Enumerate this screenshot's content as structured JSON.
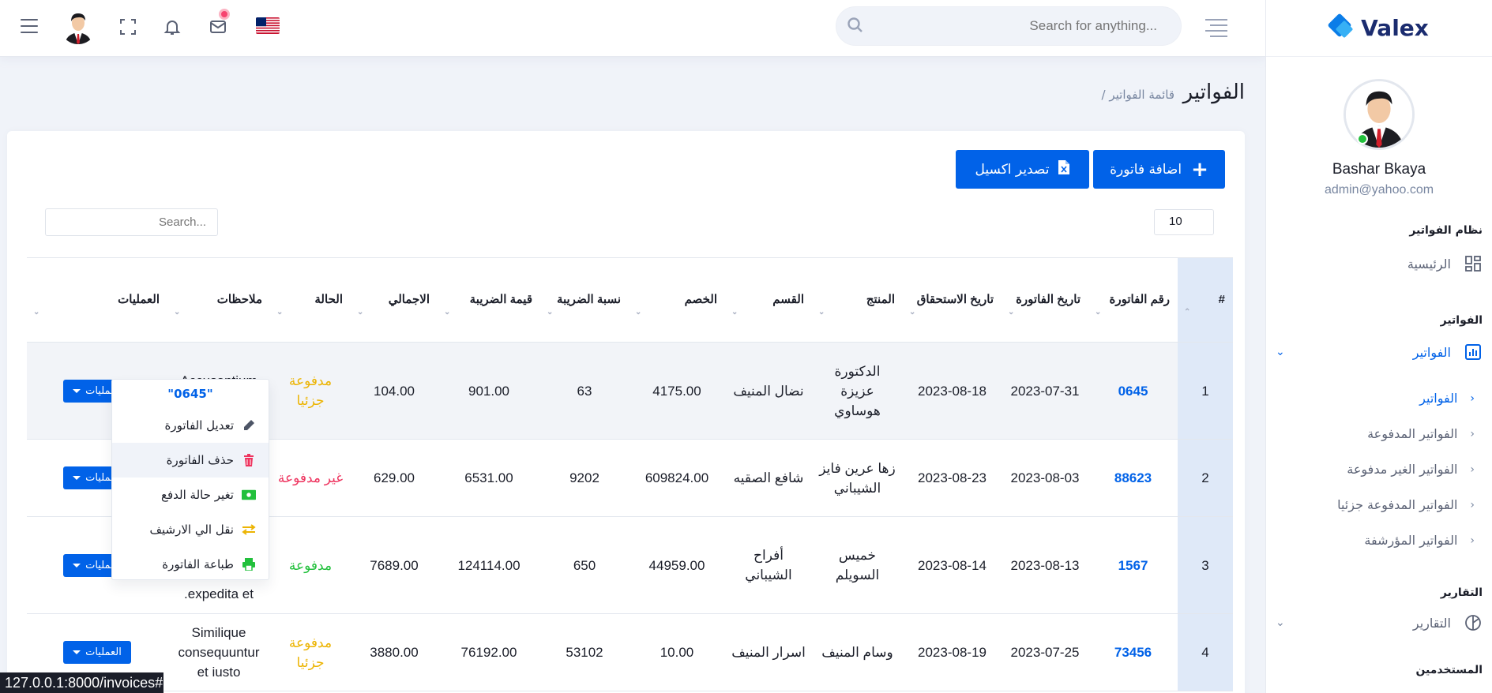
{
  "header": {
    "search_placeholder": "Search for anything...",
    "icons": [
      "menu-icon",
      "avatar",
      "fullscreen-icon",
      "bell-icon",
      "mail-icon",
      "us-flag-icon"
    ]
  },
  "sidebar": {
    "brand": "Valex",
    "user_name": "Bashar Bkaya",
    "user_email": "admin@yahoo.com",
    "section_1": "نظام الفواتير",
    "home": "الرئيسية",
    "section_2": "الفواتير",
    "invoices_menu": "الفواتير",
    "sub": [
      "الفواتير",
      "الفواتير المدفوعة",
      "الفواتير الغير مدفوعة",
      "الفواتير المدفوعة جزئيا",
      "الفواتير المؤرشفة"
    ],
    "section_3": "التقارير",
    "reports_menu": "التقارير",
    "section_4": "المستخدمين"
  },
  "page": {
    "title": "الفواتير",
    "breadcrumb": "/ قائمة الفواتير"
  },
  "toolbar": {
    "add_invoice": "اضافة فاتورة",
    "export_excel": "تصدير اكسيل",
    "page_length": "10",
    "search_placeholder": "Search..."
  },
  "table": {
    "headers": [
      "#",
      "رقم الفاتورة",
      "تاريخ الفاتورة",
      "تاريخ الاستحقاق",
      "المنتج",
      "القسم",
      "الخصم",
      "نسبة الضريبة",
      "قيمة الضريبة",
      "الاجمالي",
      "الحالة",
      "ملاحظات",
      "العمليات"
    ],
    "ops_label": "العمليات",
    "rows": [
      {
        "n": "1",
        "invoice": "0645",
        "inv_date": "2023-07-31",
        "due_date": "2023-08-18",
        "product": "الدكتورة عزيزة هوساوي",
        "section": "نضال المنيف",
        "discount": "4175.00",
        "rate": "63",
        "tax": "901.00",
        "total": "104.00",
        "status": "مدفوعة جزئيا",
        "notes": "Accusantium unde quam"
      },
      {
        "n": "2",
        "invoice": "88623",
        "inv_date": "2023-08-03",
        "due_date": "2023-08-23",
        "product": "زها عرين فايز الشيباني",
        "section": "شافع الصقيه",
        "discount": "609824.00",
        "rate": "9202",
        "tax": "6531.00",
        "total": "629.00",
        "status": "غير مدفوعة",
        "notes": ""
      },
      {
        "n": "3",
        "invoice": "1567",
        "inv_date": "2023-08-13",
        "due_date": "2023-08-14",
        "product": "خميس السويلم",
        "section": "أفراح الشيباني",
        "discount": "44959.00",
        "rate": "650",
        "tax": "124114.00",
        "total": "7689.00",
        "status": "مدفوعة",
        "notes": "expedita et."
      },
      {
        "n": "4",
        "invoice": "73456",
        "inv_date": "2023-07-25",
        "due_date": "2023-08-19",
        "product": "وسام المنيف",
        "section": "اسرار المنيف",
        "discount": "10.00",
        "rate": "53102",
        "tax": "76192.00",
        "total": "3880.00",
        "status": "مدفوعة جزئيا",
        "notes": "Similique consequuntur et iusto"
      }
    ]
  },
  "dropdown": {
    "header": "\"0645\"",
    "items": [
      "تعديل الفاتورة",
      "حذف الفاتورة",
      "تغير حالة الدفع",
      "نقل الي الارشيف",
      "طباعة الفاتورة"
    ]
  },
  "statusbar": {
    "url": "127.0.0.1:8000/invoices#"
  },
  "colors": {
    "primary": "#0162e8",
    "paid": "#22c03c",
    "unpaid": "#ee335e",
    "partial": "#ecb403"
  }
}
